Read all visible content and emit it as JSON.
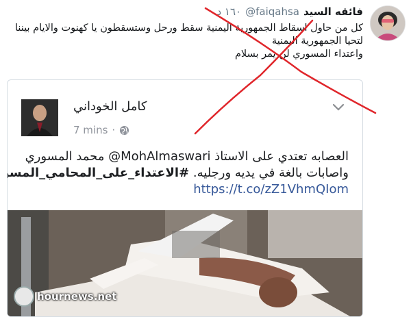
{
  "tweet": {
    "author_name": "فائقه السيد",
    "handle": "@faiqahsa",
    "time": "١٦٠ د",
    "lines": [
      "كل من حاول اسقاط الجمهورية اليمنية سقط ورحل وستسقطون يا كهنوت والايام بيننا",
      "لتحيا الجمهورية اليمنية",
      "واعتداء المسوري لن يمر بسلام"
    ]
  },
  "quoted_post": {
    "author_name": "كامل الخوداني",
    "time": "7 mins",
    "separator": "·",
    "lines": [
      "العصابه تعتدي على الاستاذ MohAlmaswari@ محمد المسوري",
      "واصابات بالغة في يديه ورجليه."
    ],
    "hashtag": "#الاعتداء_على_المحامي_المسوري",
    "link": "https://t.co/zZ1VhmQIom"
  },
  "watermark": {
    "text": "hournews.net"
  },
  "colors": {
    "cross": "#e0262b",
    "link": "#365899",
    "muted": "#657786"
  },
  "icons": [
    "globe-icon",
    "chevron-down-icon"
  ]
}
